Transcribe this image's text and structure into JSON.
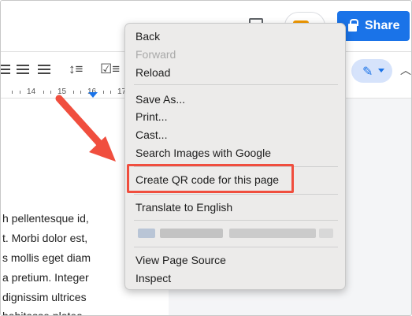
{
  "header": {
    "share_label": "Share"
  },
  "ruler": {
    "labels": [
      "14",
      "15",
      "16",
      "17"
    ]
  },
  "document": {
    "lines": [
      "h pellentesque id,",
      "t. Morbi dolor est,",
      "s mollis eget diam",
      "a pretium. Integer",
      "dignissim ultrices",
      "habitasse platea"
    ]
  },
  "context_menu": {
    "back": "Back",
    "forward": "Forward",
    "reload": "Reload",
    "save_as": "Save As...",
    "print": "Print...",
    "cast": "Cast...",
    "search_images": "Search Images with Google",
    "create_qr": "Create QR code for this page",
    "translate": "Translate to English",
    "view_source": "View Page Source",
    "inspect": "Inspect"
  },
  "colors": {
    "highlight": "#f04e3e",
    "share_button": "#1a73e8",
    "menu_background": "#ecebea"
  },
  "icons": [
    "comment-icon",
    "meet-icon",
    "lock-icon",
    "align-right-icon",
    "justify-icon",
    "line-spacing-icon",
    "checklist-icon",
    "pencil-icon",
    "chevron-up-icon",
    "annotation-arrow"
  ]
}
